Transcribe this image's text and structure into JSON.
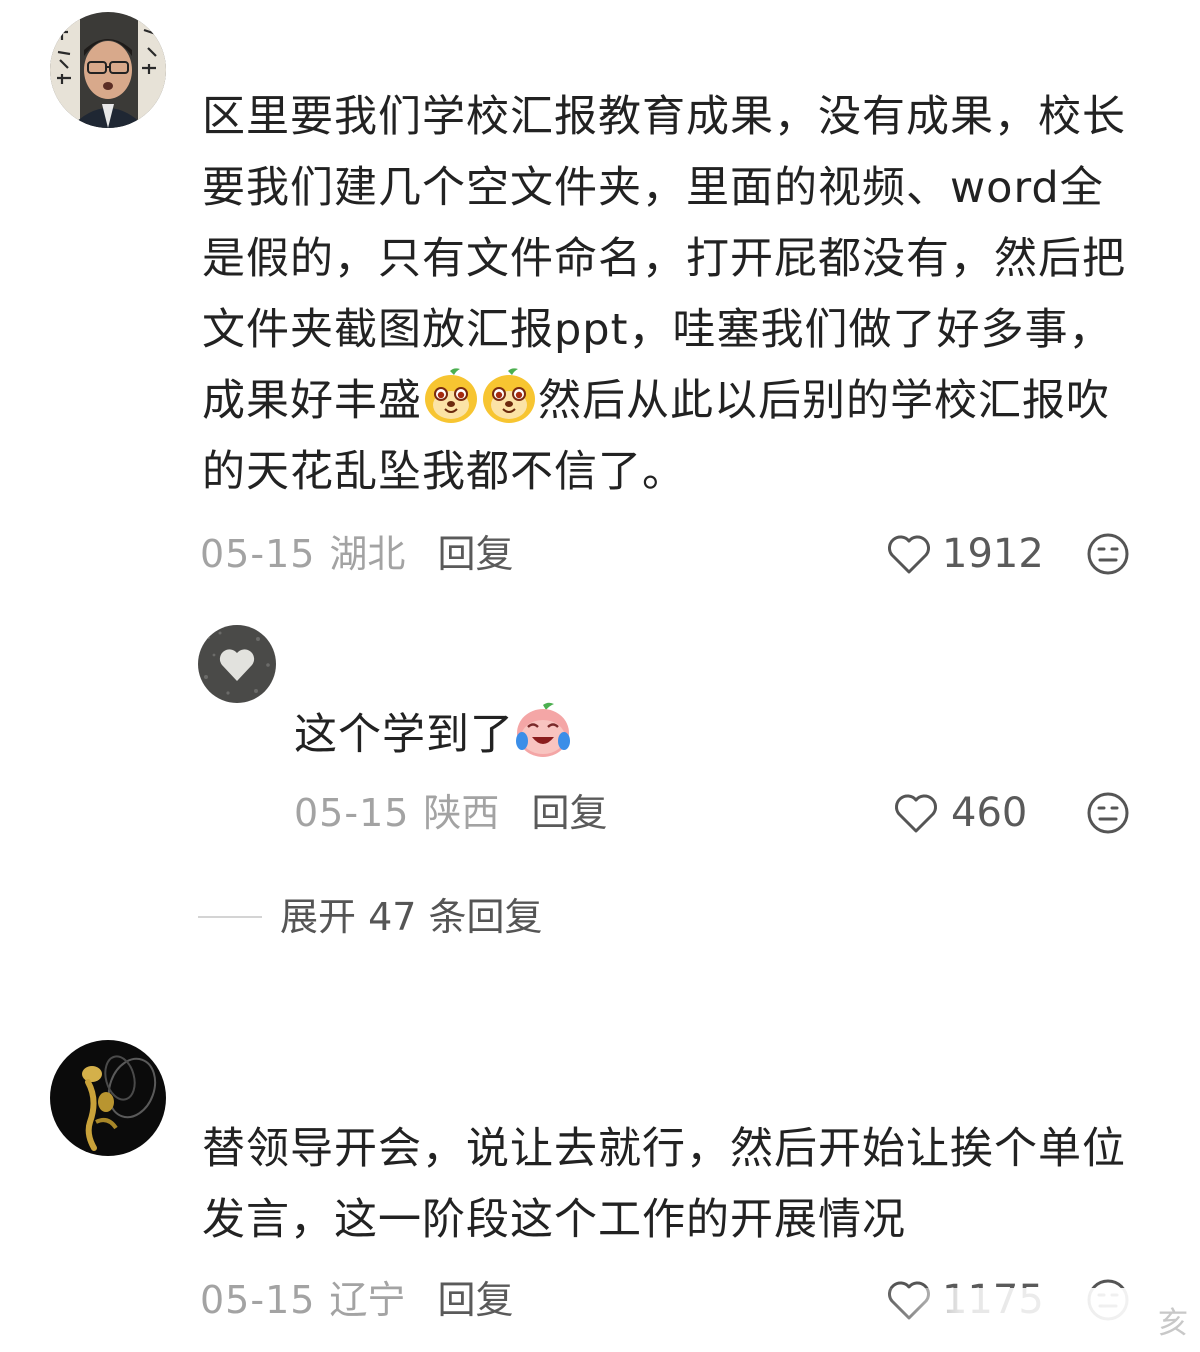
{
  "comments": [
    {
      "text_parts": [
        "区里要我们学校汇报教育成果，没有成果，校长\n要我们建几个空文件夹，里面的视频、word全\n是假的，只有文件命名，打开屁都没有，然后把\n文件夹截图放汇报ppt，哇塞我们做了好多事，\n成果好丰盛",
        "然后从此以后别的学校汇报吹\n的天花乱坠我都不信了。"
      ],
      "emojis": [
        "dog-face-emoji",
        "dog-face-emoji"
      ],
      "date": "05-15",
      "region": "湖北",
      "reply_label": "回复",
      "likes": "1912"
    },
    {
      "text": "这个学到了",
      "emoji": "crying-laughing-emoji",
      "date": "05-15",
      "region": "陕西",
      "reply_label": "回复",
      "likes": "460"
    },
    {
      "text": "替领导开会，说让去就行，然后开始让挨个单位\n发言，这一阶段这个工作的开展情况",
      "date": "05-15",
      "region": "辽宁",
      "reply_label": "回复",
      "likes": "1175"
    }
  ],
  "expand_replies_label": "展开 47 条回复",
  "watermark_char": "亥",
  "colors": {
    "text": "#222222",
    "meta": "#a3a3a3",
    "reply": "#5a5a5a",
    "emoji_yellow": "#f7c531",
    "emoji_pink": "#f4a6a6"
  }
}
